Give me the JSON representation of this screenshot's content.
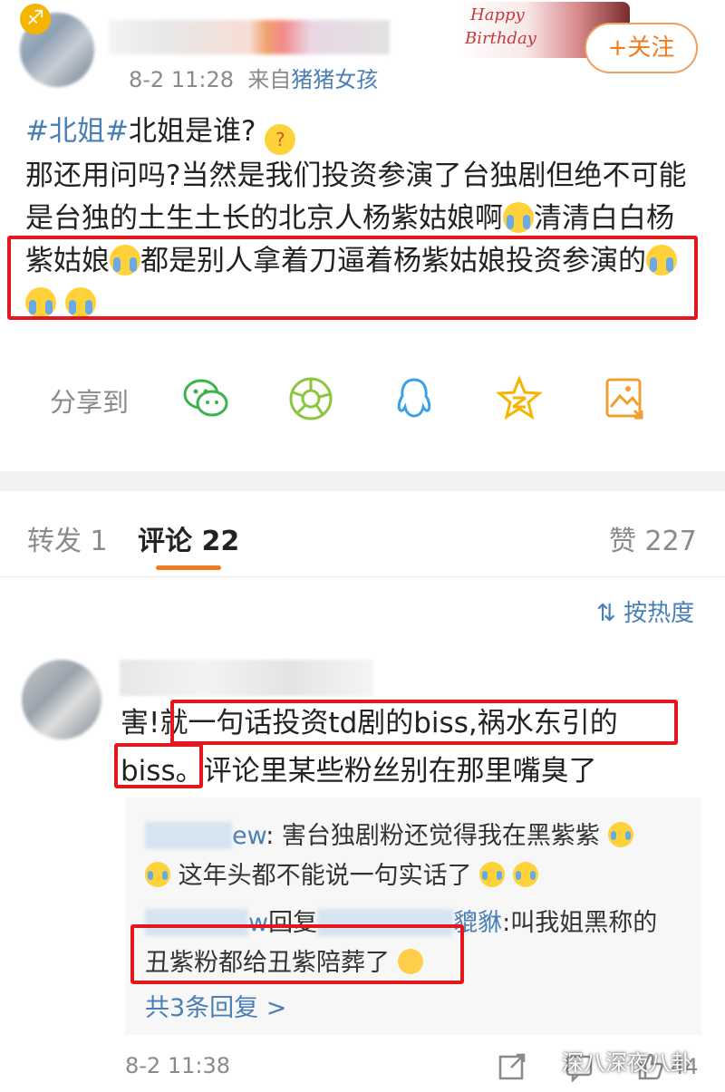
{
  "post": {
    "meta_time": "8-2 11:28",
    "meta_from": "来自",
    "meta_source": "猪猪女孩",
    "birthday_line1": "Happy",
    "birthday_line2": "Birthday",
    "follow_label": "+关注",
    "tag": "#北姐#",
    "line1_rest": "北姐是谁?",
    "body_a": "那还用问吗?当然是我们投资参演了台独剧但绝不可能是台独的土生土长的北京人杨紫姑娘啊",
    "body_b": "清清白白杨紫姑娘",
    "body_c": "都是别人拿着刀逼着杨紫姑娘投资参演的"
  },
  "share": {
    "label": "分享到",
    "icons": [
      "wechat-icon",
      "moments-icon",
      "qq-icon",
      "qzone-icon",
      "save-image-icon"
    ]
  },
  "tabs": {
    "repost": "转发 1",
    "comments": "评论 22",
    "likes": "赞 227"
  },
  "sort_label": "按热度",
  "comment": {
    "line1": "害!就一句话投资td剧的biss,祸水东引的",
    "line2": "biss。评论里某些粉丝别在那里嘴臭了",
    "reply1_user_suffix": "ew",
    "reply1_text_a": ": 害台独剧粉还觉得我在黑紫紫",
    "reply1_text_b": "这年头都不能说一句实话了",
    "reply2_user_suffix": "w",
    "reply2_reply_word": "回复",
    "reply2_target_suffix": "貔貅",
    "reply2_text_a": ":叫我姐黑称的",
    "reply2_text_b": "丑紫粉都给丑紫陪葬了",
    "more_replies": "共3条回复 >",
    "time": "8-2 11:38",
    "count": "44",
    "watermark": "深八深夜八卦"
  }
}
